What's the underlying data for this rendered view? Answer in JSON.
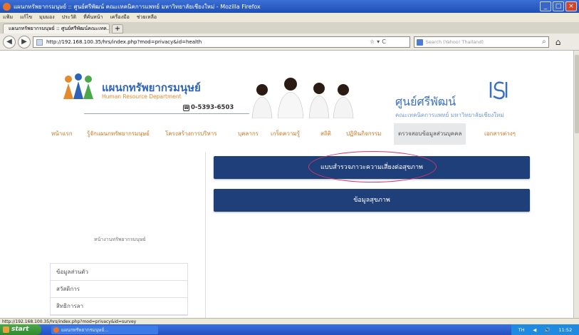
{
  "window": {
    "title": "แผนกทรัพยากรมนุษย์ :: ศูนย์ศรีพัฒน์ คณะเทคนิคการแพทย์ มหาวิทยาลัยเชียงใหม่ - Mozilla Firefox",
    "min": "_",
    "max": "□",
    "close": "×"
  },
  "menu": [
    "แฟ้ม",
    "แก้ไข",
    "มุมมอง",
    "ประวัติ",
    "ที่คั่นหน้า",
    "เครื่องมือ",
    "ช่วยเหลือ"
  ],
  "tab": {
    "label": "แผนกทรัพยากรมนุษย์ :: ศูนย์ศรีพัฒน์คณะเทค...",
    "new": "+"
  },
  "nav": {
    "back": "◀",
    "forward": "▶",
    "url": "http://192.168.100.35/hrs/index.php?mod=privacy&id=health",
    "star": "☆",
    "dropdown": "▾",
    "reload": "C",
    "search_placeholder": "Search (Yahoo! Thailand)",
    "search_go": "⌕",
    "home": "⌂"
  },
  "header": {
    "dept_th": "แผนกทรัพยากรมนุษย์",
    "dept_en": "Human Resource Department",
    "phone_icon": "☎",
    "phone": "0-5393-6503",
    "center_th": "ศูนย์ศรีพัฒน์",
    "center_sub": "คณะเทคนิคการแพทย์ มหาวิทยาลัยเชียงใหม่"
  },
  "mainnav": [
    "หน้าแรก",
    "รู้จักแผนกทรัพยากรมนุษย์",
    "โครงสร้างการบริหาร",
    "บุคลากร",
    "เกร็ดความรู้",
    "สถิติ",
    "ปฏิทินกิจกรรม",
    "ตรวจสอบข้อมูลส่วนบุคคล",
    "เอกสารต่างๆ"
  ],
  "sidebar": {
    "caption": "หน้างานทรัพยากรมนุษย์",
    "items": [
      "ข้อมูลส่วนตัว",
      "สวัสดิการ",
      "สิทธิการลา"
    ]
  },
  "main": {
    "btn_survey": "แบบสำรวจภาวะความเสี่ยงต่อสุขภาพ",
    "btn_health": "ข้อมูลสุขภาพ"
  },
  "status": {
    "url": "http://192.168.100.35/hrs/index.php?mod=privacy&id=survey"
  },
  "taskbar": {
    "start": "start",
    "task": "แผนกทรัพยากรมนุษย์...",
    "tray": [
      "TH",
      "◀",
      "🔊",
      "11:52"
    ]
  },
  "colors": {
    "nav_button": "#1e3f7a",
    "nav_text": "#c87820",
    "dept_blue": "#2f63b8",
    "highlight": "#d2386b"
  }
}
